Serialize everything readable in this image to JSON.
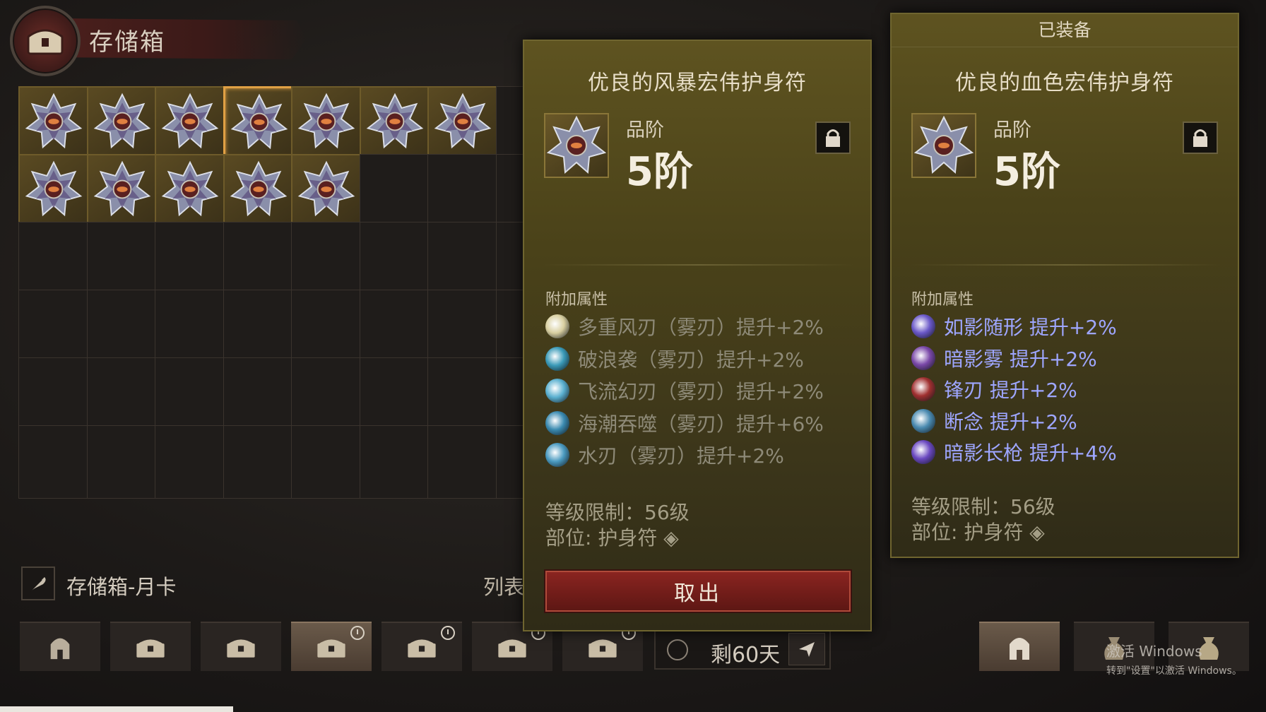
{
  "stash": {
    "title": "存储箱",
    "name": "存储箱-月卡",
    "list_label": "列表",
    "items_row1": 7,
    "items_row2": 5,
    "selected_index": 3
  },
  "timer": {
    "text": "剩60天"
  },
  "tabs": [
    {
      "icon": "helmet-icon",
      "active": false,
      "clock": false
    },
    {
      "icon": "chest-icon",
      "active": false,
      "clock": false
    },
    {
      "icon": "chest-icon",
      "active": false,
      "clock": false
    },
    {
      "icon": "chest-clock-icon",
      "active": true,
      "clock": true
    },
    {
      "icon": "chest-clock-icon",
      "active": false,
      "clock": true
    },
    {
      "icon": "chest-clock-icon",
      "active": false,
      "clock": true
    },
    {
      "icon": "chest-clock-icon",
      "active": false,
      "clock": true
    }
  ],
  "compare_item": {
    "name": "优良的风暴宏伟护身符",
    "rank_label": "品阶",
    "rank_value": "5阶",
    "attr_title": "附加属性",
    "attrs": [
      "多重风刃（雾刃）提升+2%",
      "破浪袭（雾刃）提升+2%",
      "飞流幻刃（雾刃）提升+2%",
      "海潮吞噬（雾刃）提升+6%",
      "水刃（雾刃）提升+2%"
    ],
    "level_req": "等级限制：56级",
    "slot": "部位: 护身符",
    "button": "取出"
  },
  "equipped_item": {
    "header": "已装备",
    "name": "优良的血色宏伟护身符",
    "rank_label": "品阶",
    "rank_value": "5阶",
    "attr_title": "附加属性",
    "attrs": [
      "如影随形  提升+2%",
      "暗影雾  提升+2%",
      "锋刃  提升+2%",
      "断念  提升+2%",
      "暗影长枪  提升+4%"
    ],
    "level_req": "等级限制：56级",
    "slot": "部位: 护身符"
  },
  "watermark": {
    "line1": "激活 Windows",
    "line2": "转到\"设置\"以激活 Windows。"
  },
  "colors": {
    "panel_bg": "#4a4219",
    "selected_border": "#e0a044",
    "button_red": "#8a2420",
    "equipped_attr_text": "#9ea6ff"
  }
}
